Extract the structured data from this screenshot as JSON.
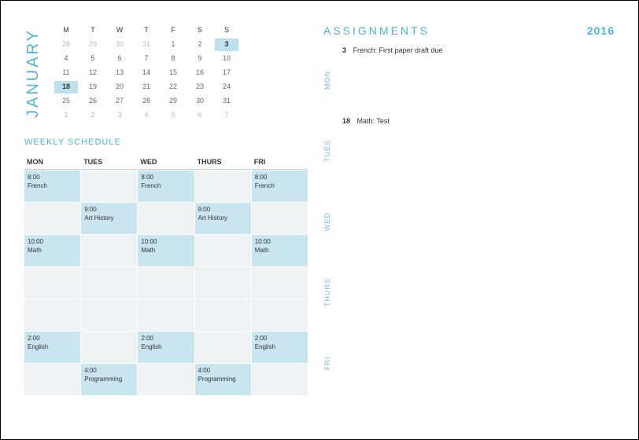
{
  "calendar": {
    "month_label": "JANUARY",
    "day_headers": [
      "M",
      "T",
      "W",
      "T",
      "F",
      "S",
      "S"
    ],
    "rows": [
      [
        {
          "n": "28",
          "muted": true
        },
        {
          "n": "29",
          "muted": true
        },
        {
          "n": "30",
          "muted": true
        },
        {
          "n": "31",
          "muted": true
        },
        {
          "n": "1"
        },
        {
          "n": "2"
        },
        {
          "n": "3",
          "hl": true
        }
      ],
      [
        {
          "n": "4"
        },
        {
          "n": "5"
        },
        {
          "n": "6"
        },
        {
          "n": "7"
        },
        {
          "n": "8"
        },
        {
          "n": "9"
        },
        {
          "n": "10"
        }
      ],
      [
        {
          "n": "11"
        },
        {
          "n": "12"
        },
        {
          "n": "13"
        },
        {
          "n": "14"
        },
        {
          "n": "15"
        },
        {
          "n": "16"
        },
        {
          "n": "17"
        }
      ],
      [
        {
          "n": "18",
          "hl": true
        },
        {
          "n": "19"
        },
        {
          "n": "20"
        },
        {
          "n": "21"
        },
        {
          "n": "22"
        },
        {
          "n": "23"
        },
        {
          "n": "24"
        }
      ],
      [
        {
          "n": "25"
        },
        {
          "n": "26"
        },
        {
          "n": "27"
        },
        {
          "n": "28"
        },
        {
          "n": "29"
        },
        {
          "n": "30"
        },
        {
          "n": "31"
        }
      ],
      [
        {
          "n": "1",
          "muted": true
        },
        {
          "n": "2",
          "muted": true
        },
        {
          "n": "3",
          "muted": true
        },
        {
          "n": "4",
          "muted": true
        },
        {
          "n": "5",
          "muted": true
        },
        {
          "n": "6",
          "muted": true
        },
        {
          "n": "7",
          "muted": true
        }
      ]
    ]
  },
  "weekly": {
    "title": "WEEKLY SCHEDULE",
    "headers": [
      "MON",
      "TUES",
      "WED",
      "THURS",
      "FRI"
    ],
    "rows": [
      [
        {
          "t": "8:00\nFrench",
          "hl": true
        },
        {
          "t": ""
        },
        {
          "t": "8:00\nFrench",
          "hl": true
        },
        {
          "t": ""
        },
        {
          "t": "8:00\nFrench",
          "hl": true
        }
      ],
      [
        {
          "t": ""
        },
        {
          "t": "9:00\nArt History",
          "hl": true
        },
        {
          "t": ""
        },
        {
          "t": "9:00\nArt History",
          "hl": true
        },
        {
          "t": ""
        }
      ],
      [
        {
          "t": "10:00\nMath",
          "hl": true
        },
        {
          "t": ""
        },
        {
          "t": "10:00\nMath",
          "hl": true
        },
        {
          "t": ""
        },
        {
          "t": "10:00\nMath",
          "hl": true
        }
      ],
      [
        {
          "t": ""
        },
        {
          "t": ""
        },
        {
          "t": ""
        },
        {
          "t": ""
        },
        {
          "t": ""
        }
      ],
      [
        {
          "t": ""
        },
        {
          "t": ""
        },
        {
          "t": ""
        },
        {
          "t": ""
        },
        {
          "t": ""
        }
      ],
      [
        {
          "t": "2:00\nEnglish",
          "hl": true
        },
        {
          "t": ""
        },
        {
          "t": "2:00\nEnglish",
          "hl": true
        },
        {
          "t": ""
        },
        {
          "t": "2:00\nEnglish",
          "hl": true
        }
      ],
      [
        {
          "t": ""
        },
        {
          "t": "4:00\nProgramming",
          "hl": true
        },
        {
          "t": ""
        },
        {
          "t": "4:00\nProgramming",
          "hl": true
        },
        {
          "t": ""
        }
      ]
    ]
  },
  "assignments": {
    "title": "ASSIGNMENTS",
    "year": "2016",
    "days": [
      {
        "label": "MON",
        "date": "3",
        "text": "French: First paper draft due"
      },
      {
        "label": "TUES",
        "date": "18",
        "text": "Math: Test"
      },
      {
        "label": "WED",
        "date": "",
        "text": ""
      },
      {
        "label": "THURS",
        "date": "",
        "text": ""
      },
      {
        "label": "FRI",
        "date": "",
        "text": ""
      }
    ]
  }
}
